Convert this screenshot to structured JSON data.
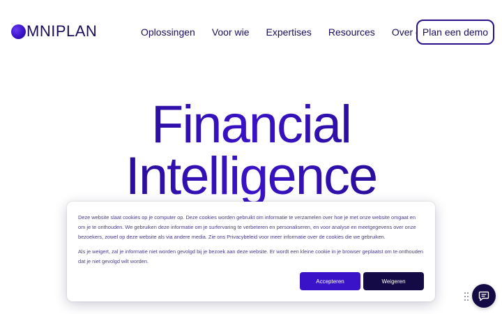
{
  "brand": {
    "logo_text": "MNIPLAN",
    "logo_icon": "omniplan-circle-logo",
    "color_primary": "#3a12c8",
    "color_dark": "#140a45"
  },
  "nav": {
    "items": [
      {
        "label": "Oplossingen"
      },
      {
        "label": "Voor wie"
      },
      {
        "label": "Expertises"
      },
      {
        "label": "Resources"
      },
      {
        "label": "Over ons"
      }
    ],
    "cta_label": "Plan een demo"
  },
  "hero": {
    "line1": "Financial",
    "line2": "Intelligence"
  },
  "cookie_banner": {
    "paragraph1": "Deze website slaat cookies op je computer op. Deze cookies worden gebruikt om informatie te verzamelen over hoe je met onze website omgaat en om je te onthouden. We gebruiken deze informatie om je surfervaring te verbeteren en personaliseren, en voor analyse en meetgegevens over onze bezoekers, zowel op deze website als via andere media. Zie ons Privacybeleid voor meer informatie over de cookies die we gebruiken.",
    "paragraph2": "Als je weigert, zal je informatie niet worden gevolgd bij je bezoek aan deze website. Er wordt een kleine cookie in je browser geplaatst om te onthouden dat je niet gevolgd wilt worden.",
    "accept_label": "Accepteren",
    "reject_label": "Weigeren"
  },
  "widgets": {
    "chat_icon": "chat-bubble-icon",
    "drag_icon": "drag-handle-icon"
  }
}
